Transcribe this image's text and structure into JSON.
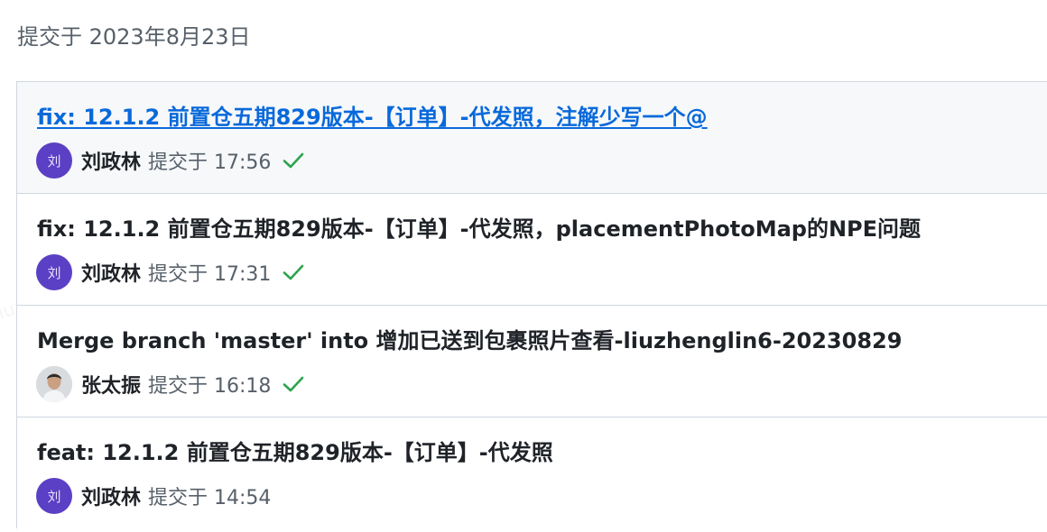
{
  "header": {
    "date_text": "提交于 2023年8月23日"
  },
  "watermark": {
    "text": "liuzhenglin6"
  },
  "colors": {
    "link": "#0969da",
    "avatar_bg": "#5b3fc4",
    "success": "#2da44e",
    "active_row_bg": "#f6f8fa"
  },
  "commits": [
    {
      "title": "fix: 12.1.2 前置仓五期829版本-【订单】-代发照，注解少写一个@",
      "avatar_text": "刘",
      "author": "刘政林",
      "time": "提交于 17:56",
      "status_icon": "check-icon",
      "active": true
    },
    {
      "title": "fix: 12.1.2 前置仓五期829版本-【订单】-代发照，placementPhotoMap的NPE问题",
      "avatar_text": "刘",
      "author": "刘政林",
      "time": "提交于 17:31",
      "status_icon": "check-icon",
      "active": false
    },
    {
      "title": "Merge branch 'master' into 增加已送到包裹照片查看-liuzhenglin6-20230829",
      "avatar_text": "",
      "author": "张太振",
      "time": "提交于 16:18",
      "status_icon": "check-icon",
      "active": false
    },
    {
      "title": "feat: 12.1.2 前置仓五期829版本-【订单】-代发照",
      "avatar_text": "刘",
      "author": "刘政林",
      "time": "提交于 14:54",
      "status_icon": "",
      "active": false
    }
  ]
}
